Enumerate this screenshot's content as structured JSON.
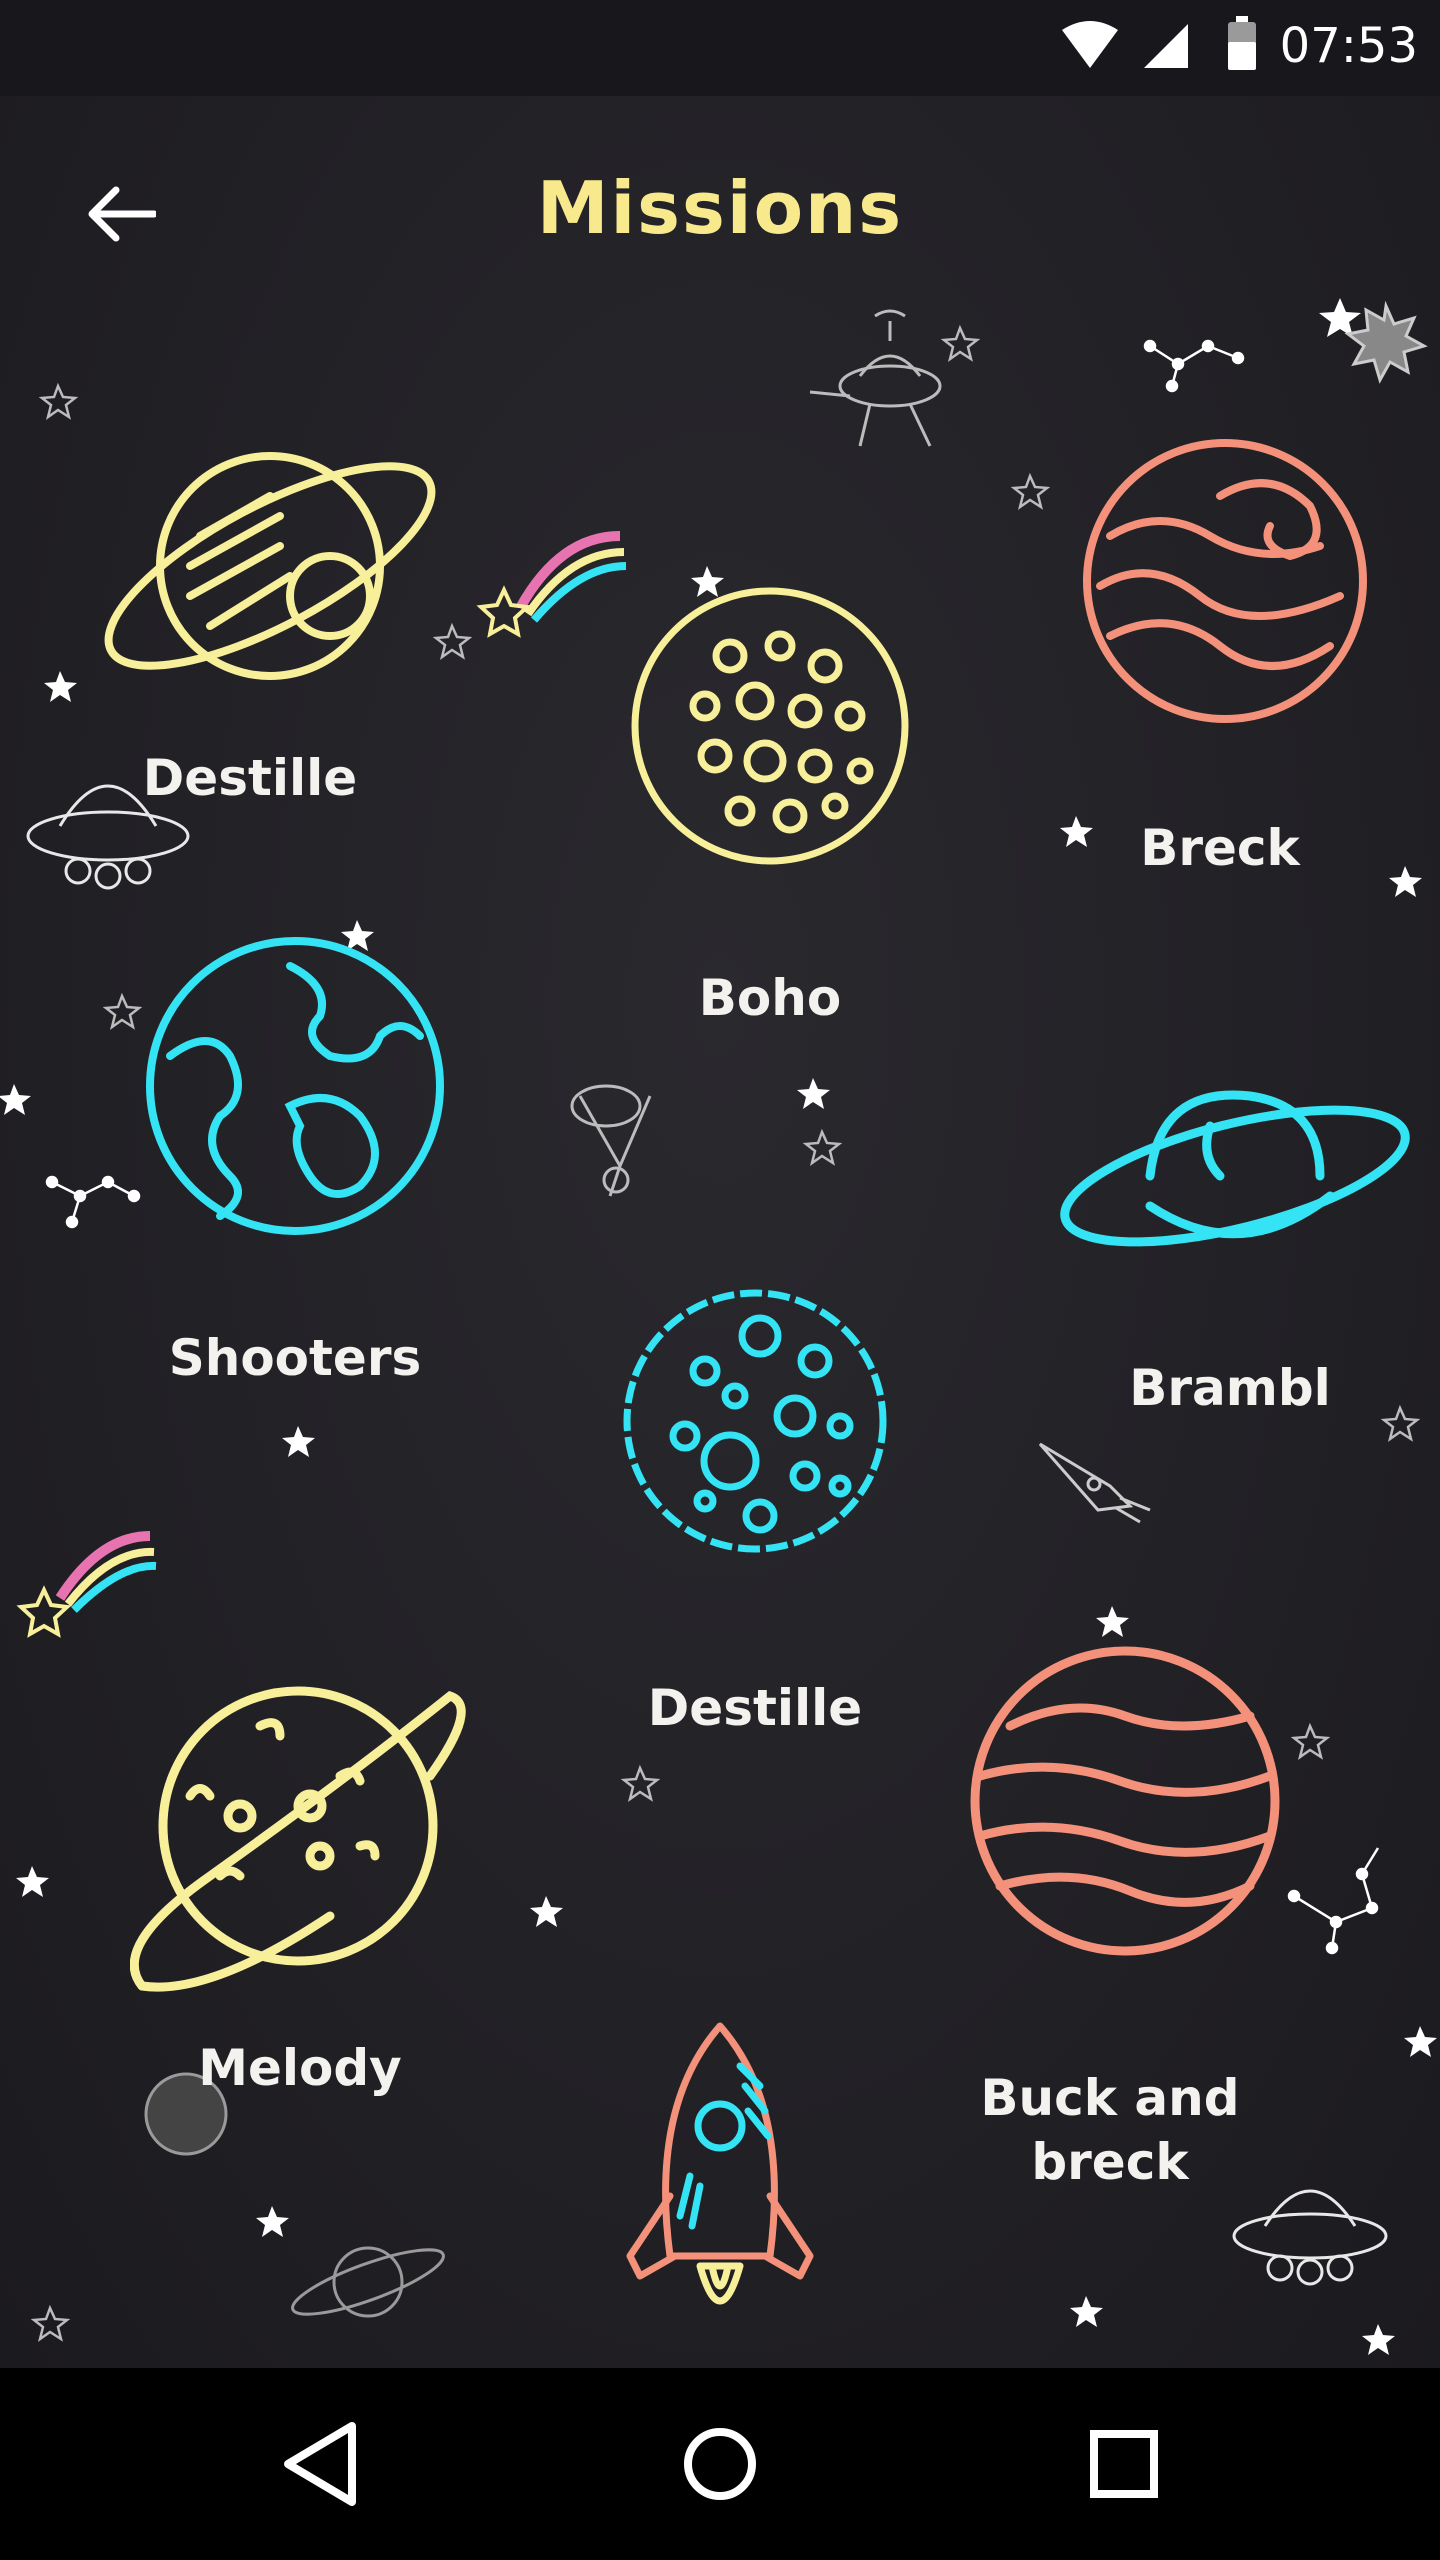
{
  "status_bar": {
    "time": "07:53",
    "icons": [
      "wifi-icon",
      "cell-signal-icon",
      "battery-icon"
    ]
  },
  "header": {
    "title": "Missions",
    "back_icon": "arrow-left-icon"
  },
  "missions": [
    {
      "label": "Destille",
      "icon": "ringed-planet-icon",
      "color": "#f8ef9a"
    },
    {
      "label": "Boho",
      "icon": "crater-planet-icon",
      "color": "#f8ef9a"
    },
    {
      "label": "Breck",
      "icon": "swirl-planet-icon",
      "color": "#f4917a"
    },
    {
      "label": "Shooters",
      "icon": "earth-icon",
      "color": "#34e4f4"
    },
    {
      "label": "Brambl",
      "icon": "saturn-icon",
      "color": "#34e4f4"
    },
    {
      "label": "Destille",
      "icon": "moon-icon",
      "color": "#34e4f4"
    },
    {
      "label": "Melody",
      "icon": "spotted-ringed-planet-icon",
      "color": "#f8ef9a"
    },
    {
      "label": "Buck and breck",
      "icon": "striped-planet-icon",
      "color": "#f4917a"
    }
  ],
  "rocket": {
    "icon": "rocket-icon",
    "colors": [
      "#f4917a",
      "#34e4f4",
      "#f8ef9a"
    ]
  },
  "nav_bar": {
    "icons": [
      "back-triangle-icon",
      "home-circle-icon",
      "recents-square-icon"
    ]
  },
  "colors": {
    "background": "#1f1e23",
    "title": "#f8e98c",
    "yellow": "#f8ef9a",
    "cyan": "#34e4f4",
    "salmon": "#f4917a"
  }
}
